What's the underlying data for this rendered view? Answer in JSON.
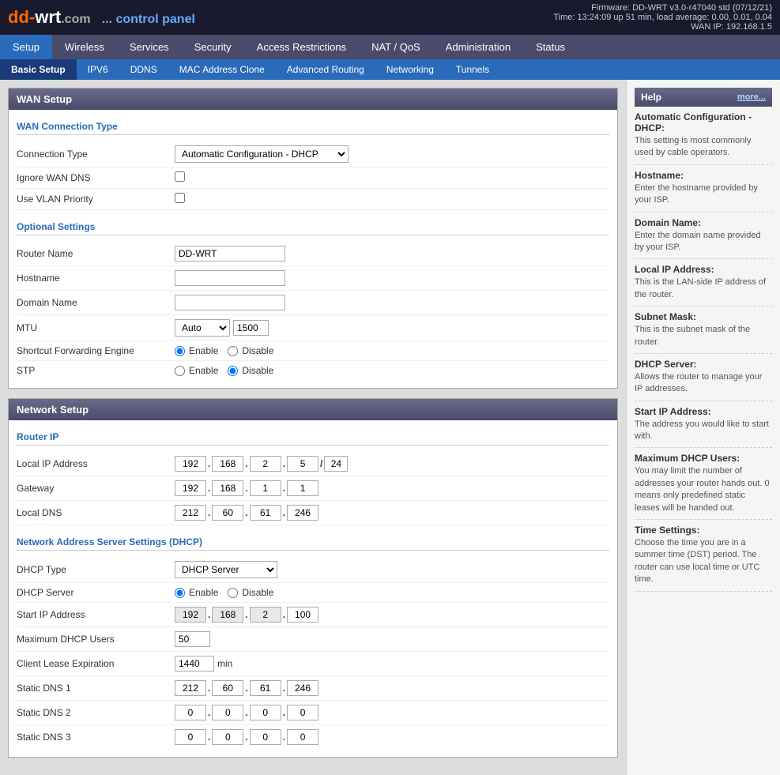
{
  "header": {
    "logo": "dd-wrt",
    "logo_dot": ".com",
    "logo_sub": "... control panel",
    "firmware": "Firmware: DD-WRT v3.0-r47040 std (07/12/21)",
    "time": "Time: 13:24:09 up 51 min, load average: 0.00, 0.01, 0.04",
    "wan_ip": "WAN IP: 192.168.1.5"
  },
  "nav_top": {
    "items": [
      {
        "label": "Setup",
        "active": true
      },
      {
        "label": "Wireless",
        "active": false
      },
      {
        "label": "Services",
        "active": false
      },
      {
        "label": "Security",
        "active": false
      },
      {
        "label": "Access Restrictions",
        "active": false
      },
      {
        "label": "NAT / QoS",
        "active": false
      },
      {
        "label": "Administration",
        "active": false
      },
      {
        "label": "Status",
        "active": false
      }
    ]
  },
  "nav_sub": {
    "items": [
      {
        "label": "Basic Setup",
        "active": true
      },
      {
        "label": "IPV6",
        "active": false
      },
      {
        "label": "DDNS",
        "active": false
      },
      {
        "label": "MAC Address Clone",
        "active": false
      },
      {
        "label": "Advanced Routing",
        "active": false
      },
      {
        "label": "Networking",
        "active": false
      },
      {
        "label": "Tunnels",
        "active": false
      }
    ]
  },
  "wan_setup": {
    "title": "WAN Setup",
    "wan_connection_type": {
      "title": "WAN Connection Type",
      "connection_type_label": "Connection Type",
      "connection_type_value": "Automatic Configuration - DHCP",
      "ignore_wan_dns_label": "Ignore WAN DNS",
      "use_vlan_priority_label": "Use VLAN Priority"
    },
    "optional_settings": {
      "title": "Optional Settings",
      "router_name_label": "Router Name",
      "router_name_value": "DD-WRT",
      "hostname_label": "Hostname",
      "hostname_value": "",
      "domain_name_label": "Domain Name",
      "domain_name_value": "",
      "mtu_label": "MTU",
      "mtu_type": "Auto",
      "mtu_value": "1500",
      "sfe_label": "Shortcut Forwarding Engine",
      "stp_label": "STP",
      "enable_label": "Enable",
      "disable_label": "Disable"
    }
  },
  "network_setup": {
    "title": "Network Setup",
    "router_ip": {
      "title": "Router IP",
      "local_ip_label": "Local IP Address",
      "local_ip": {
        "a": "192",
        "b": "168",
        "c": "2",
        "d": "5",
        "prefix": "24"
      },
      "gateway_label": "Gateway",
      "gateway": {
        "a": "192",
        "b": "168",
        "c": "1",
        "d": "1"
      },
      "local_dns_label": "Local DNS",
      "local_dns": {
        "a": "212",
        "b": "60",
        "c": "61",
        "d": "246"
      }
    },
    "dhcp": {
      "title": "Network Address Server Settings (DHCP)",
      "dhcp_type_label": "DHCP Type",
      "dhcp_type_value": "DHCP Server",
      "dhcp_server_label": "DHCP Server",
      "start_ip_label": "Start IP Address",
      "start_ip": {
        "a": "192",
        "b": "168",
        "c": "2",
        "d": "100"
      },
      "max_users_label": "Maximum DHCP Users",
      "max_users_value": "50",
      "client_lease_label": "Client Lease Expiration",
      "client_lease_value": "1440",
      "min_label": "min",
      "static_dns1_label": "Static DNS 1",
      "static_dns1": {
        "a": "212",
        "b": "60",
        "c": "61",
        "d": "246"
      },
      "static_dns2_label": "Static DNS 2",
      "static_dns2": {
        "a": "0",
        "b": "0",
        "c": "0",
        "d": "0"
      },
      "static_dns3_label": "Static DNS 3",
      "static_dns3": {
        "a": "0",
        "b": "0",
        "c": "0",
        "d": "0"
      }
    }
  },
  "help": {
    "title": "Help",
    "more_label": "more...",
    "items": [
      {
        "title": "Automatic Configuration - DHCP:",
        "text": "This setting is most commonly used by cable operators."
      },
      {
        "title": "Hostname:",
        "text": "Enter the hostname provided by your ISP."
      },
      {
        "title": "Domain Name:",
        "text": "Enter the domain name provided by your ISP."
      },
      {
        "title": "Local IP Address:",
        "text": "This is the LAN-side IP address of the router."
      },
      {
        "title": "Subnet Mask:",
        "text": "This is the subnet mask of the router."
      },
      {
        "title": "DHCP Server:",
        "text": "Allows the router to manage your IP addresses."
      },
      {
        "title": "Start IP Address:",
        "text": "The address you would like to start with."
      },
      {
        "title": "Maximum DHCP Users:",
        "text": "You may limit the number of addresses your router hands out. 0 means only predefined static leases will be handed out."
      },
      {
        "title": "Time Settings:",
        "text": "Choose the time you are in a summer time (DST) period. The router can use local time or UTC time."
      }
    ]
  }
}
